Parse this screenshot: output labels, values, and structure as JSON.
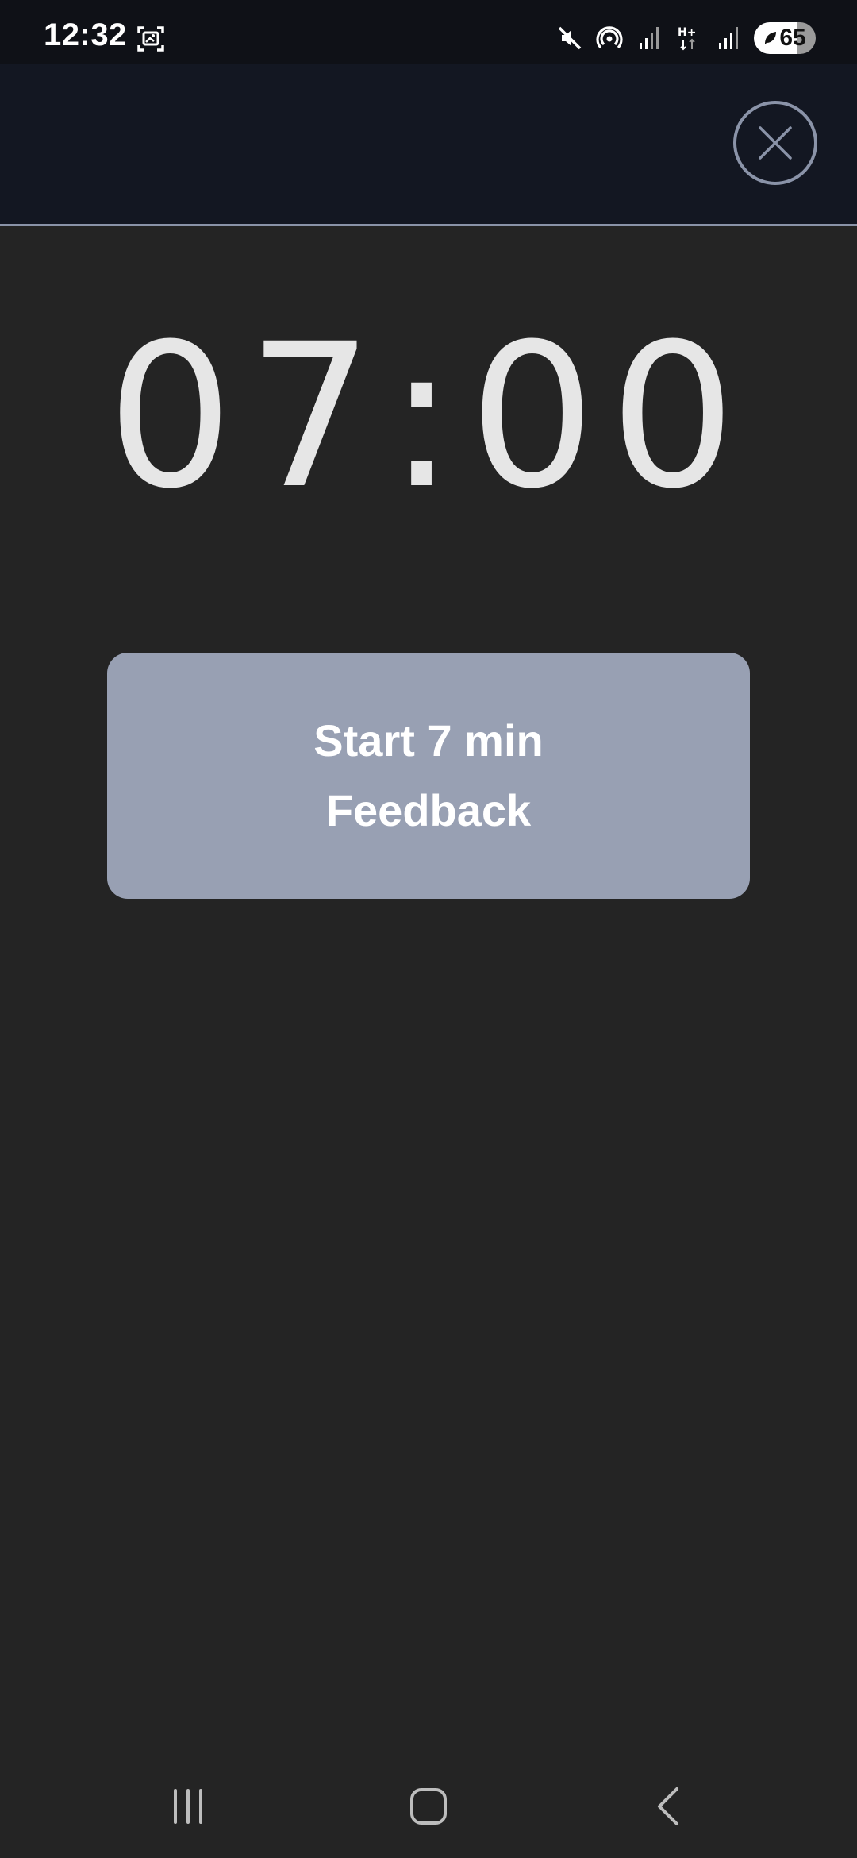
{
  "status_bar": {
    "time": "12:32",
    "battery_level": "65",
    "icons": [
      "screenshot-icon",
      "mute-icon",
      "hotspot-icon",
      "signal-icon",
      "hplus-data-icon",
      "signal-icon",
      "battery-icon"
    ]
  },
  "header": {
    "close_icon": "close-icon"
  },
  "timer": {
    "display": "07:00"
  },
  "start_button": {
    "line1": "Start 7 min",
    "line2": "Feedback"
  },
  "nav_bar": {
    "icons": [
      "recent-apps-icon",
      "home-icon",
      "back-icon"
    ]
  },
  "colors": {
    "background": "#242424",
    "header_bg": "#131722",
    "button_bg": "#98a0b3",
    "accent_outline": "#8a93a8",
    "timer_text": "#e6e6e6"
  }
}
